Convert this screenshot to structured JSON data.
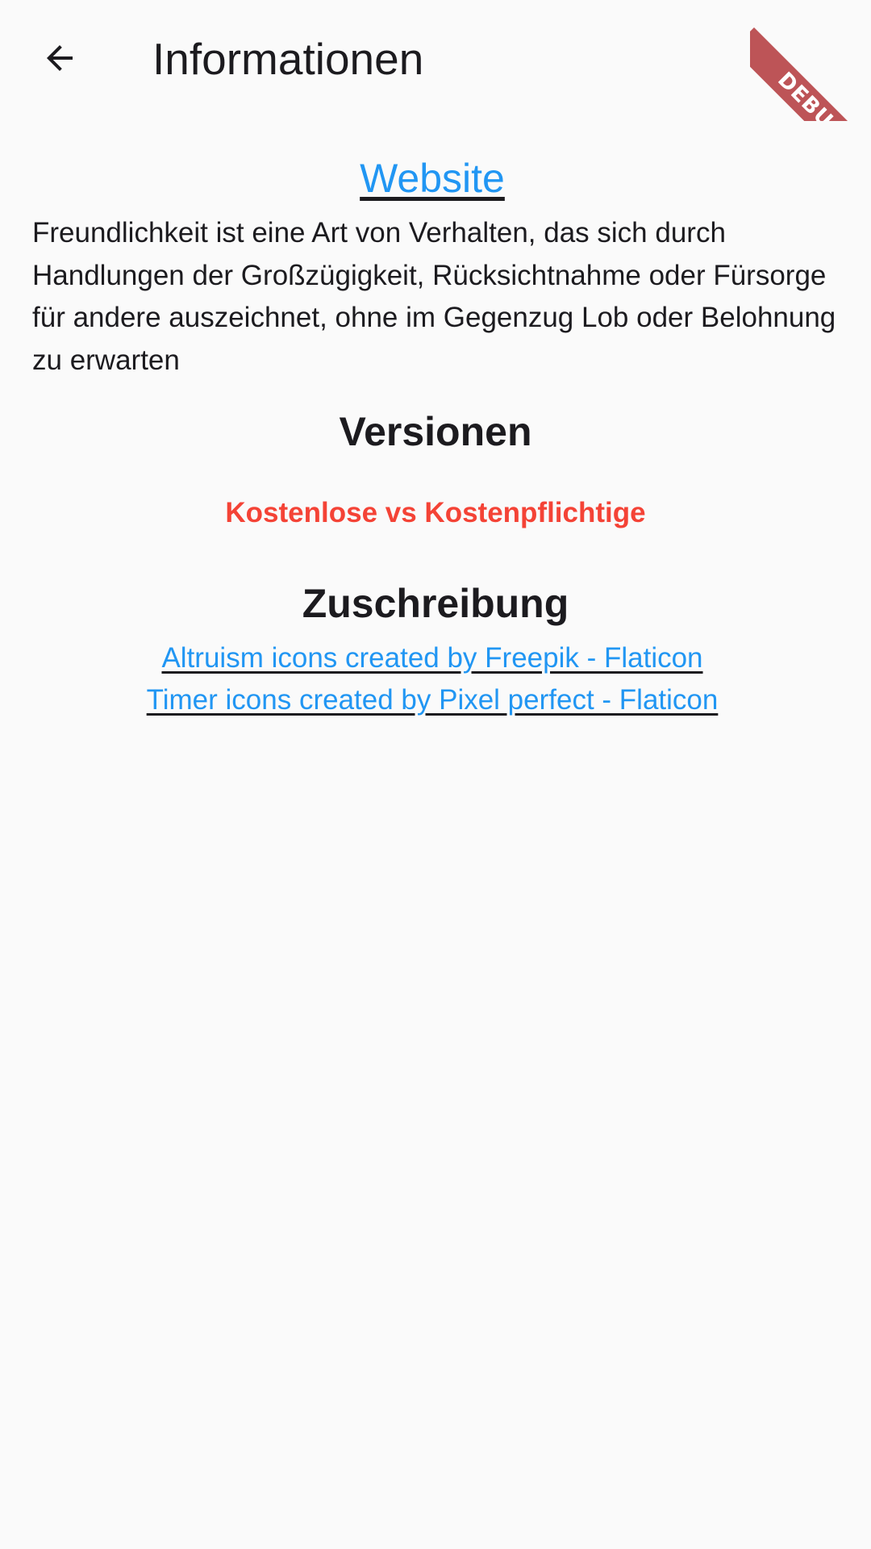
{
  "app_bar": {
    "title": "Informationen",
    "back_icon": "arrow-back-icon"
  },
  "debug_banner": {
    "label": "DEBUG",
    "color": "#b8474a"
  },
  "content": {
    "website_link": "Website",
    "description": "Freundlichkeit ist eine Art von Verhalten, das sich durch Handlungen der Großzügigkeit, Rücksichtnahme oder Fürsorge für andere auszeichnet, ohne im Gegenzug Lob oder Belohnung zu erwarten",
    "versions_heading": "Versionen",
    "versions_link": "Kostenlose vs Kostenpflichtige",
    "attribution_heading": "Zuschreibung",
    "attribution_links": [
      "Altruism icons created by Freepik - Flaticon",
      "Timer icons created by Pixel perfect - Flaticon"
    ]
  },
  "colors": {
    "link": "#2196f3",
    "accent_red": "#f44336",
    "background": "#fafafa",
    "text": "#1c1b1f"
  }
}
